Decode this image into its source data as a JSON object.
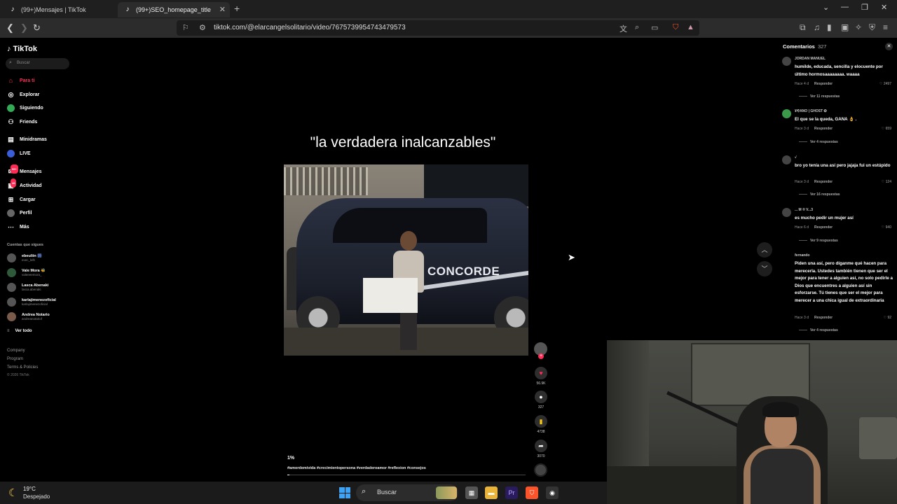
{
  "browser": {
    "tabs": [
      {
        "label": "(99+)Mensajes | TikTok",
        "icon": "tiktok-icon"
      },
      {
        "label": "(99+)SEO_homepage_title",
        "icon": "tiktok-icon"
      }
    ],
    "url": "tiktok.com/@elarcangelsolitario/video/7675739954743479573"
  },
  "sidebar": {
    "logo": "TikTok",
    "search_placeholder": "Buscar",
    "nav": [
      {
        "label": "Para ti",
        "icon": "home-icon",
        "active": true
      },
      {
        "label": "Explorar",
        "icon": "compass-icon"
      },
      {
        "label": "Siguiendo",
        "icon": "following-icon"
      },
      {
        "label": "Friends",
        "icon": "friends-icon"
      },
      {
        "label": "Minidramas",
        "icon": "minidramas-icon"
      },
      {
        "label": "LIVE",
        "icon": "live-icon"
      },
      {
        "label": "Mensajes",
        "icon": "messages-icon",
        "badge": "99+"
      },
      {
        "label": "Actividad",
        "icon": "activity-icon",
        "badge": "48"
      },
      {
        "label": "Cargar",
        "icon": "upload-icon"
      },
      {
        "label": "Perfil",
        "icon": "profile-icon"
      },
      {
        "label": "Más",
        "icon": "more-icon"
      }
    ],
    "following_title": "Cuentas que sigues",
    "following": [
      {
        "name": "ebeuliin 🎆",
        "handle": "evec_lelh"
      },
      {
        "name": "Vale Mora 🐝",
        "handle": "valeeeemora_"
      },
      {
        "name": "Lasca Abenaki",
        "handle": "lasca.abenaki"
      },
      {
        "name": "karlajimenezoficial",
        "handle": "karlajimenezoficial"
      },
      {
        "name": "Andrea Notario",
        "handle": "andreanotariof"
      }
    ],
    "see_all": "Ver todo",
    "footer": [
      "Company",
      "Program",
      "Terms & Policies"
    ],
    "copyright": "© 2026 TikTok"
  },
  "video": {
    "title": "\"la verdadera inalcanzables\"",
    "van_brand": "CONCORDE",
    "progress_label": "1%",
    "progress": 0.01,
    "hashtags": "#amordemivida #crecimientopersona #verdaderoamor #reflexion #consejos",
    "actions": {
      "likes": "56.9K",
      "comments": "327",
      "saves": "4738",
      "shares": "3070"
    }
  },
  "comments": {
    "title": "Comentarios",
    "count": "327",
    "items": [
      {
        "user": "JORDAN MANUEL",
        "text": "humilde, educada, sencilla y elocuente por último hormosaaaaaaaa. waaaa",
        "time": "Hace 4 d",
        "reply": "Responder",
        "likes": "2497",
        "more": "Ver 11 respuestas"
      },
      {
        "user": "¥ҾANO | GHOST ✪",
        "text": "El que se la queda, GANA 👌 .",
        "time": "Hace 3 d",
        "reply": "Responder",
        "likes": "659",
        "more": "Ver 4 respuestas"
      },
      {
        "user": "√",
        "text": "bro yo tenía una así pero jajaja fui un estúpido",
        "time": "Hace 3 d",
        "reply": "Responder",
        "likes": "124",
        "more": "Ver 16 respuestas"
      },
      {
        "user": "... M ® V...3",
        "text": "es mucho pedir un mujer así",
        "time": "Hace 6 d",
        "reply": "Responder",
        "likes": "940",
        "more": "Ver 9 respuestas"
      },
      {
        "user": "fernando",
        "text": "Piden una así, pero díganme qué hacen para merecerla. Ustedes también tienen que ser el mejor para tener a alguien así, no solo pedirle a Dios que encuentres a alguien así sin esforzarse. Tú tienes que ser el mejor para merecer a una chica igual de extraordinaria",
        "time": "Hace 3 d",
        "reply": "Responder",
        "likes": "92",
        "more": "Ver 4 respuestas"
      }
    ]
  },
  "taskbar": {
    "temperature": "19°C",
    "condition": "Despejado",
    "search": "Buscar"
  },
  "colors": {
    "accent": "#fe2c55",
    "background": "#000000",
    "chrome": "#2c2c2c"
  }
}
